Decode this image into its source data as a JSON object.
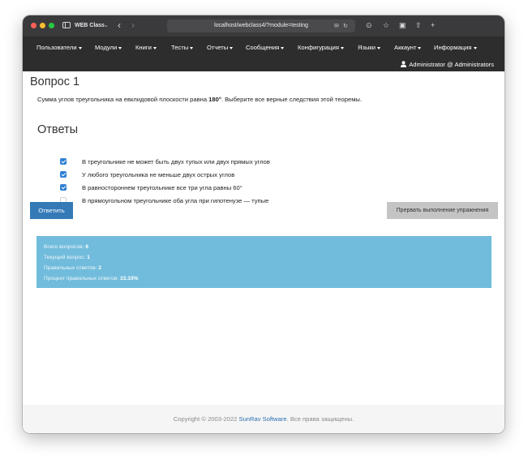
{
  "browser": {
    "tab_title": "WEB Class",
    "url": "localhost/webclass4/?module=testing"
  },
  "navbar": {
    "menu": [
      {
        "label": "Пользователи"
      },
      {
        "label": "Модули"
      },
      {
        "label": "Книги"
      },
      {
        "label": "Тесты"
      },
      {
        "label": "Отчеты"
      },
      {
        "label": "Сообщения"
      },
      {
        "label": "Конфигурация"
      },
      {
        "label": "Языки"
      },
      {
        "label": "Аккаунт"
      },
      {
        "label": "Информация"
      }
    ],
    "user": "Administrator @ Administrators"
  },
  "question": {
    "title": "Вопрос 1",
    "text_before": "Сумма углов треугольника на евклидовой плоскости равна ",
    "text_bold": "180°",
    "text_after": ". Выберите все верные следствия этой теоремы."
  },
  "answers": {
    "title": "Ответы",
    "items": [
      {
        "label": "В треугольнике не может быть двух тупых или двух прямых углов",
        "checked": true
      },
      {
        "label": "У любого треугольника не меньше двух острых углов",
        "checked": true
      },
      {
        "label": "В равностороннем треугольнике все три угла равны 60°",
        "checked": true
      },
      {
        "label": "В прямоугольном треугольнике оба угла при гипотенузе — тупые",
        "checked": false
      }
    ]
  },
  "buttons": {
    "answer": "Ответить",
    "abort": "Прервать выполнение упражнения"
  },
  "stats": {
    "total_label": "Всего вопросов:",
    "total_value": "6",
    "current_label": "Текущий вопрос:",
    "current_value": "1",
    "correct_label": "Правильных ответов:",
    "correct_value": "2",
    "percent_label": "Процент правильных ответов:",
    "percent_value": "33.33%"
  },
  "footer": {
    "copyright": "Copyright © 2003-2022 ",
    "company": "SunRav Software",
    "rights": ". Все права защищены."
  },
  "colors": {
    "primary": "#337ab7",
    "navbar": "#2d2d2d",
    "stats_bg": "#71bcdc",
    "checkbox": "#2f7fd4"
  }
}
